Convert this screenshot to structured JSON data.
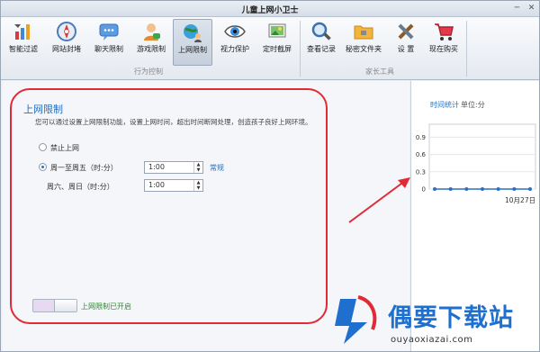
{
  "window": {
    "title": "儿童上网小卫士",
    "minimize_glyph": "─",
    "close_glyph": "✕"
  },
  "toolbar": {
    "groups": [
      {
        "label": "行为控制"
      },
      {
        "label": "家长工具"
      }
    ],
    "items": [
      {
        "label": "智能过滤",
        "icon": "filter-chart-icon"
      },
      {
        "label": "网站封堵",
        "icon": "compass-icon"
      },
      {
        "label": "聊天限制",
        "icon": "chat-icon"
      },
      {
        "label": "游戏限制",
        "icon": "game-user-icon"
      },
      {
        "label": "上网限制",
        "icon": "globe-user-icon",
        "active": true
      },
      {
        "label": "视力保护",
        "icon": "eye-icon"
      },
      {
        "label": "定时截屏",
        "icon": "screenshot-icon"
      },
      {
        "label": "查看记录",
        "icon": "magnifier-icon"
      },
      {
        "label": "秘密文件夹",
        "icon": "folder-icon"
      },
      {
        "label": "设 置",
        "icon": "tools-icon"
      },
      {
        "label": "现在购买",
        "icon": "cart-icon"
      }
    ]
  },
  "main": {
    "heading": "上网限制",
    "description": "您可以通过设置上网限制功能，设置上网时间，超出时间断网处理，创造孩子良好上网环境。",
    "options": [
      {
        "label": "禁止上网",
        "selected": false
      },
      {
        "label": "周一至周五（时:分）",
        "selected": true,
        "value": "1:00",
        "link": "常规"
      },
      {
        "label": "周六、周日（时:分）",
        "value": "1:00"
      }
    ],
    "toggle_label": "上网限制已开启",
    "toggle_state": "on"
  },
  "stats": {
    "title": "时间统计",
    "unit": "单位:分",
    "chart_data": {
      "type": "line",
      "title": "",
      "ylim": [
        0,
        1
      ],
      "yticks": [
        "0.9",
        "0.6",
        "0.3",
        "0"
      ],
      "x_tick_label": "10月27日",
      "series": [
        {
          "values": [
            0,
            0,
            0,
            0,
            0,
            0,
            0
          ]
        }
      ],
      "grid": true
    }
  },
  "watermark": {
    "title": "偶要下载站",
    "url": "ouyaoxiazai.com"
  },
  "colors": {
    "accent": "#1e6fc2",
    "highlight_border": "#e02a35",
    "toggle_text": "#2d8a2d"
  }
}
